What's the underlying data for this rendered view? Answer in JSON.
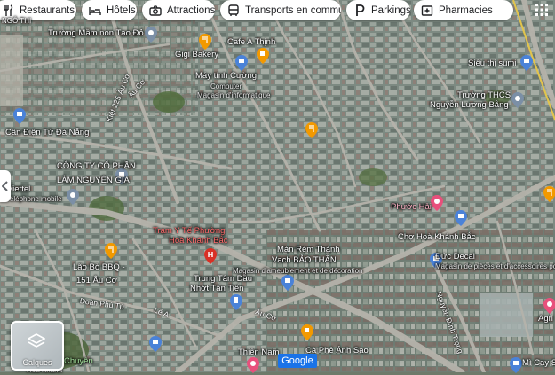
{
  "filter_chips": [
    {
      "label": "Restaurants",
      "icon": "fork-knife-icon"
    },
    {
      "label": "Hôtels",
      "icon": "bed-icon"
    },
    {
      "label": "Attractions",
      "icon": "camera-icon"
    },
    {
      "label": "Transports en commun",
      "icon": "bus-icon"
    },
    {
      "label": "Parkings",
      "icon": "parking-icon"
    },
    {
      "label": "Pharmacies",
      "icon": "pharmacy-icon"
    }
  ],
  "places": {
    "tao_do": "Trường Mầm non Tạo Đỏ",
    "cafe_thinh": "Cafe A Thịnh",
    "gigi": "Gigi Bakery",
    "may_tinh": "Máy tính Cường",
    "may_tinh_sub": "Computer",
    "may_tinh_sub2": "Magasin d'informatique",
    "sieu_thi": "Siêu thị sumi",
    "truong_thcs": "Trường THCS",
    "nguyen_luong_bang": "Nguyễn Lương Bằng",
    "can_dien": "Cân Điện Tử Đà Nẵng",
    "cong_ty": "CÔNG TY CỔ PHẦN",
    "cong_ty2": "LÂM NGUYÊN GIA",
    "viettel": "Viettel",
    "viettel_sub": "Téléphone mobile",
    "tram_y_te": "Trạm Y Tế Phường",
    "tram_y_te2": "Hoà Khánh Bắc",
    "lao_bo": "Lão Bò BBQ -",
    "lao_bo2": "151 Âu Cơ",
    "man_rem": "Màn Rèm Thành",
    "man_rem2": "Vạch BẢO THÂN",
    "man_rem_sub": "Magasin d'ameublement et de décoration",
    "phuoc_hai": "Phước Hải",
    "cho_hoa_khanh": "Chợ Hoà Khánh Bắc",
    "duc_decal": "Đức Decal",
    "duc_decal_sub": "Magasin de pièces et d'accessoires pour",
    "trung_tam": "Trung Tâm Dầu",
    "trung_tam2": "Nhớt Tấn Tiến",
    "cafe_anh_sao": "Cà Phê Ánh Sao",
    "thien_nam": "Thiên Nam",
    "chuyen": "Chuyên",
    "hoa_khanh": "Hoà Khánh",
    "mi_cay": "Mì Cay Sa",
    "agri": "Agri"
  },
  "streets": {
    "au_co_top": "Âu Cơ",
    "kiet_au_co": "Kiệt 225 Âu Cơ",
    "au_co_bottom": "Âu Cơ",
    "doan_phu_tu": "Đoàn Phú Tứ",
    "le_a": "Lê A",
    "nguyen_dinh_trong": "Nguyễn Đình Trọng",
    "ngo_thi": "NGÔ THỊ"
  },
  "layers_button": {
    "label": "Calques"
  },
  "google_logo": "Google",
  "colors": {
    "chip_bg": "#ffffff",
    "accent_blue": "#1a73e8",
    "pin_orange": "#f29900",
    "pin_pink": "#e8507c",
    "pin_red": "#d93025"
  }
}
